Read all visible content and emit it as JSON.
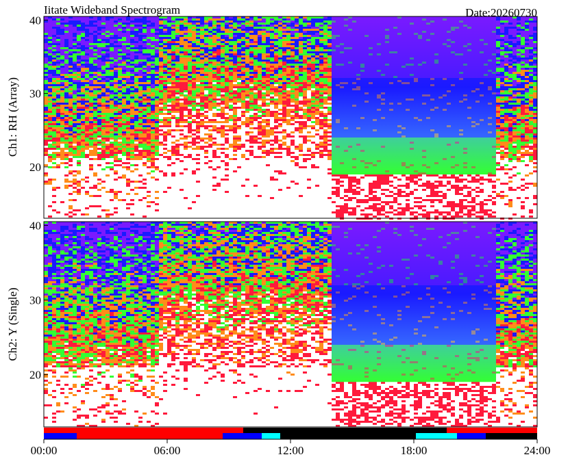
{
  "title": "Iitate Wideband Spectrogram",
  "date_label": "Date:20260730",
  "chart_data": [
    {
      "type": "heatmap",
      "ylabel": "Ch1: RH (Array)",
      "yticks": [
        20,
        30,
        40
      ],
      "ylim": [
        13,
        40.5
      ],
      "xlim": [
        0,
        24
      ],
      "quiet_window_hours": [
        14,
        22
      ],
      "palette": [
        "#ffffff",
        "#ff1a3c",
        "#ff8c1a",
        "#33ff33",
        "#1a1aff",
        "#7a1aff"
      ]
    },
    {
      "type": "heatmap",
      "ylabel": "Ch2: Y (Single)",
      "yticks": [
        20,
        30,
        40
      ],
      "ylim": [
        13,
        40.5
      ],
      "xlim": [
        0,
        24
      ],
      "quiet_window_hours": [
        14,
        22
      ],
      "palette": [
        "#ffffff",
        "#ff1a3c",
        "#ff8c1a",
        "#33ff33",
        "#1a1aff",
        "#7a1aff"
      ]
    }
  ],
  "x_axis": {
    "tick_hours": [
      0,
      6,
      12,
      18,
      24
    ],
    "tick_labels": [
      "00:00",
      "06:00",
      "12:00",
      "18:00",
      "24:00"
    ]
  },
  "status_bars": {
    "upper": [
      {
        "start": 0,
        "end": 9.7,
        "color": "#ff0000"
      },
      {
        "start": 9.7,
        "end": 19.6,
        "color": "#000000"
      },
      {
        "start": 19.6,
        "end": 24,
        "color": "#ff0000"
      }
    ],
    "lower": [
      {
        "start": 0,
        "end": 1.6,
        "color": "#0000ff"
      },
      {
        "start": 1.6,
        "end": 8.7,
        "color": "#ff0000"
      },
      {
        "start": 8.7,
        "end": 10.6,
        "color": "#0000ff"
      },
      {
        "start": 10.6,
        "end": 11.5,
        "color": "#00ffff"
      },
      {
        "start": 11.5,
        "end": 18.1,
        "color": "#000000"
      },
      {
        "start": 18.1,
        "end": 20.1,
        "color": "#00ffff"
      },
      {
        "start": 20.1,
        "end": 21.5,
        "color": "#0000ff"
      },
      {
        "start": 21.5,
        "end": 24,
        "color": "#000000"
      }
    ]
  }
}
